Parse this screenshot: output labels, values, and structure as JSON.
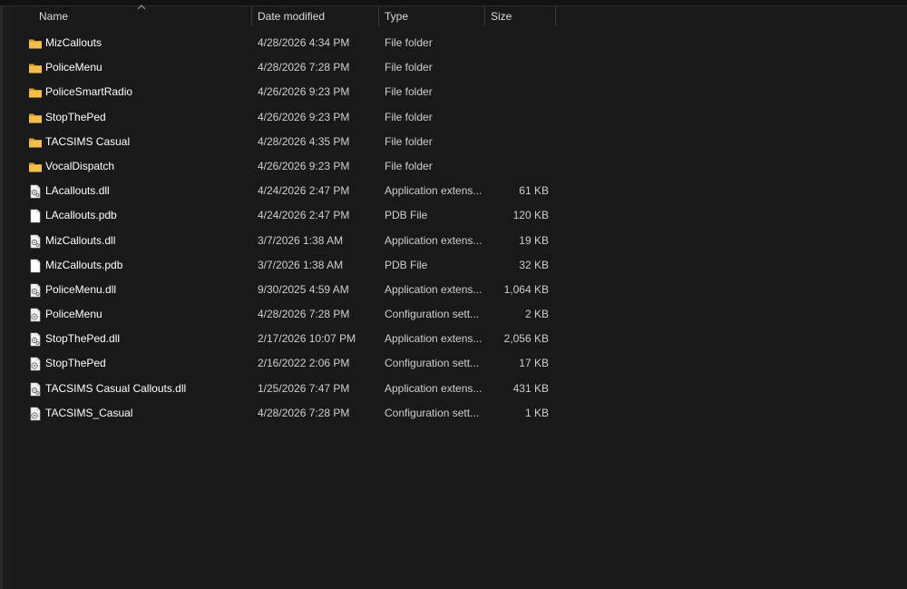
{
  "columns": {
    "name": "Name",
    "date": "Date modified",
    "type": "Type",
    "size": "Size"
  },
  "sort": {
    "column": "name",
    "icon": "chevron-up-icon"
  },
  "files": [
    {
      "name": "MizCallouts",
      "date": "4/28/2026 4:34 PM",
      "type": "File folder",
      "size": "",
      "icon": "folder-icon"
    },
    {
      "name": "PoliceMenu",
      "date": "4/28/2026 7:28 PM",
      "type": "File folder",
      "size": "",
      "icon": "folder-icon"
    },
    {
      "name": "PoliceSmartRadio",
      "date": "4/26/2026 9:23 PM",
      "type": "File folder",
      "size": "",
      "icon": "folder-icon"
    },
    {
      "name": "StopThePed",
      "date": "4/26/2026 9:23 PM",
      "type": "File folder",
      "size": "",
      "icon": "folder-icon"
    },
    {
      "name": "TACSIMS Casual",
      "date": "4/28/2026 4:35 PM",
      "type": "File folder",
      "size": "",
      "icon": "folder-icon"
    },
    {
      "name": "VocalDispatch",
      "date": "4/26/2026 9:23 PM",
      "type": "File folder",
      "size": "",
      "icon": "folder-icon"
    },
    {
      "name": "LAcallouts.dll",
      "date": "4/24/2026 2:47 PM",
      "type": "Application extens...",
      "size": "61 KB",
      "icon": "dll-file-icon"
    },
    {
      "name": "LAcallouts.pdb",
      "date": "4/24/2026 2:47 PM",
      "type": "PDB File",
      "size": "120 KB",
      "icon": "blank-file-icon"
    },
    {
      "name": "MizCallouts.dll",
      "date": "3/7/2026 1:38 AM",
      "type": "Application extens...",
      "size": "19 KB",
      "icon": "dll-file-icon"
    },
    {
      "name": "MizCallouts.pdb",
      "date": "3/7/2026 1:38 AM",
      "type": "PDB File",
      "size": "32 KB",
      "icon": "blank-file-icon"
    },
    {
      "name": "PoliceMenu.dll",
      "date": "9/30/2025 4:59 AM",
      "type": "Application extens...",
      "size": "1,064 KB",
      "icon": "dll-file-icon"
    },
    {
      "name": "PoliceMenu",
      "date": "4/28/2026 7:28 PM",
      "type": "Configuration sett...",
      "size": "2 KB",
      "icon": "config-file-icon"
    },
    {
      "name": "StopThePed.dll",
      "date": "2/17/2026 10:07 PM",
      "type": "Application extens...",
      "size": "2,056 KB",
      "icon": "dll-file-icon"
    },
    {
      "name": "StopThePed",
      "date": "2/16/2022 2:06 PM",
      "type": "Configuration sett...",
      "size": "17 KB",
      "icon": "config-file-icon"
    },
    {
      "name": "TACSIMS Casual Callouts.dll",
      "date": "1/25/2026 7:47 PM",
      "type": "Application extens...",
      "size": "431 KB",
      "icon": "dll-file-icon"
    },
    {
      "name": "TACSIMS_Casual",
      "date": "4/28/2026 7:28 PM",
      "type": "Configuration sett...",
      "size": "1 KB",
      "icon": "config-file-icon"
    }
  ],
  "colors": {
    "background": "#191919",
    "folder": "#f2c04a",
    "folder_dark": "#d9a22e",
    "text": "#ffffff",
    "secondary_text": "#cfcfcf"
  }
}
